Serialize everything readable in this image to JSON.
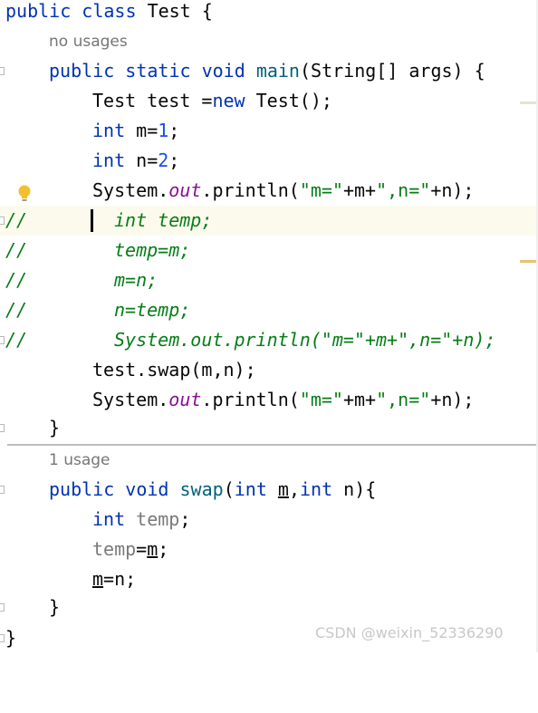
{
  "class_decl": {
    "kw1": "public",
    "kw2": "class",
    "name": "Test",
    "brace": "{"
  },
  "hints": {
    "main_usages": "no usages",
    "swap_usages": "1 usage"
  },
  "main_decl": {
    "kw1": "public",
    "kw2": "static",
    "kw3": "void",
    "method": "main",
    "params": "(String[] args) {"
  },
  "line_new": {
    "lhs": "Test test =",
    "kw": "new",
    "rhs": " Test();"
  },
  "line_m": {
    "kw": "int",
    "pre": " m=",
    "num": "1",
    "end": ";"
  },
  "line_n": {
    "kw": "int",
    "pre": " n=",
    "num": "2",
    "end": ";"
  },
  "println": {
    "obj": "System.",
    "field": "out",
    "call": ".println(",
    "s1": "\"m=\"",
    "mid": "+m+",
    "s2": "\",n=\"",
    "end": "+n);"
  },
  "comment_marker": "//",
  "comments": [
    "int temp;",
    "temp=m;",
    "m=n;",
    "n=temp;",
    "System.out.println(\"m=\"+m+\",n=\"+n);"
  ],
  "swap_call": "test.swap(m,n);",
  "close_brace": "}",
  "swap_decl": {
    "kw1": "public",
    "kw2": "void",
    "method": "swap",
    "open": "(",
    "kw3": "int",
    "p1": "m",
    "sep": ",",
    "kw4": "int",
    "p2": " n){"
  },
  "swap_body": {
    "l1_kw": "int",
    "l1_var": "temp",
    "l1_end": ";",
    "l2_var": "temp",
    "l2_eq": "=",
    "l2_m": "m",
    "l2_end": ";",
    "l3_m": "m",
    "l3_rest": "=n;"
  },
  "watermark": "CSDN @weixin_52336290",
  "colors": {
    "keyword": "#0033b3",
    "string": "#067d17",
    "static_field": "#871094",
    "method_decl": "#00627a",
    "number": "#1750eb",
    "comment": "#067d17",
    "current_line": "#fcfaed",
    "bulb": "#f2c02e",
    "scroll_marker": "#e8c26f"
  }
}
